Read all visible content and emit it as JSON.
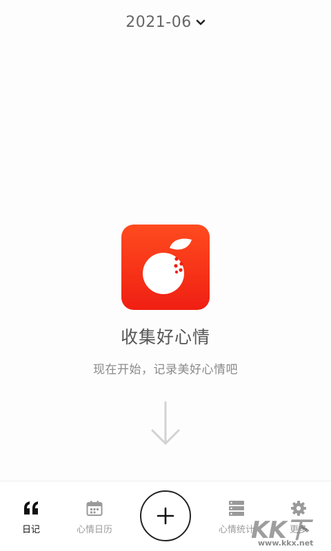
{
  "header": {
    "month": "2021-06"
  },
  "empty_state": {
    "title": "收集好心情",
    "subtitle": "现在开始，记录美好心情吧"
  },
  "bottom_nav": {
    "items": [
      {
        "label": "日记",
        "icon": "quote-icon",
        "active": true
      },
      {
        "label": "心情日历",
        "icon": "calendar-icon",
        "active": false
      },
      {
        "label": "心情统计",
        "icon": "stats-list-icon",
        "active": false
      },
      {
        "label": "更多",
        "icon": "gear-icon",
        "active": false
      }
    ],
    "add_icon": "plus-icon"
  },
  "watermark": {
    "logo_text": "KK下载",
    "url": "www.kkx.net"
  },
  "colors": {
    "brand_red": "#f01f12",
    "brand_orange": "#ff4b1f",
    "active_nav": "#111111",
    "inactive_nav": "#9a9a9a"
  }
}
